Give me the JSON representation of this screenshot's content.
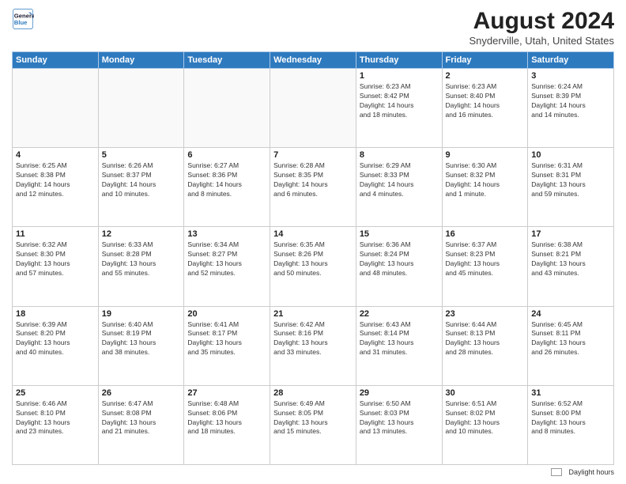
{
  "header": {
    "logo_line1": "General",
    "logo_line2": "Blue",
    "title": "August 2024",
    "subtitle": "Snyderville, Utah, United States"
  },
  "days_of_week": [
    "Sunday",
    "Monday",
    "Tuesday",
    "Wednesday",
    "Thursday",
    "Friday",
    "Saturday"
  ],
  "weeks": [
    [
      {
        "day": "",
        "info": ""
      },
      {
        "day": "",
        "info": ""
      },
      {
        "day": "",
        "info": ""
      },
      {
        "day": "",
        "info": ""
      },
      {
        "day": "1",
        "info": "Sunrise: 6:23 AM\nSunset: 8:42 PM\nDaylight: 14 hours\nand 18 minutes."
      },
      {
        "day": "2",
        "info": "Sunrise: 6:23 AM\nSunset: 8:40 PM\nDaylight: 14 hours\nand 16 minutes."
      },
      {
        "day": "3",
        "info": "Sunrise: 6:24 AM\nSunset: 8:39 PM\nDaylight: 14 hours\nand 14 minutes."
      }
    ],
    [
      {
        "day": "4",
        "info": "Sunrise: 6:25 AM\nSunset: 8:38 PM\nDaylight: 14 hours\nand 12 minutes."
      },
      {
        "day": "5",
        "info": "Sunrise: 6:26 AM\nSunset: 8:37 PM\nDaylight: 14 hours\nand 10 minutes."
      },
      {
        "day": "6",
        "info": "Sunrise: 6:27 AM\nSunset: 8:36 PM\nDaylight: 14 hours\nand 8 minutes."
      },
      {
        "day": "7",
        "info": "Sunrise: 6:28 AM\nSunset: 8:35 PM\nDaylight: 14 hours\nand 6 minutes."
      },
      {
        "day": "8",
        "info": "Sunrise: 6:29 AM\nSunset: 8:33 PM\nDaylight: 14 hours\nand 4 minutes."
      },
      {
        "day": "9",
        "info": "Sunrise: 6:30 AM\nSunset: 8:32 PM\nDaylight: 14 hours\nand 1 minute."
      },
      {
        "day": "10",
        "info": "Sunrise: 6:31 AM\nSunset: 8:31 PM\nDaylight: 13 hours\nand 59 minutes."
      }
    ],
    [
      {
        "day": "11",
        "info": "Sunrise: 6:32 AM\nSunset: 8:30 PM\nDaylight: 13 hours\nand 57 minutes."
      },
      {
        "day": "12",
        "info": "Sunrise: 6:33 AM\nSunset: 8:28 PM\nDaylight: 13 hours\nand 55 minutes."
      },
      {
        "day": "13",
        "info": "Sunrise: 6:34 AM\nSunset: 8:27 PM\nDaylight: 13 hours\nand 52 minutes."
      },
      {
        "day": "14",
        "info": "Sunrise: 6:35 AM\nSunset: 8:26 PM\nDaylight: 13 hours\nand 50 minutes."
      },
      {
        "day": "15",
        "info": "Sunrise: 6:36 AM\nSunset: 8:24 PM\nDaylight: 13 hours\nand 48 minutes."
      },
      {
        "day": "16",
        "info": "Sunrise: 6:37 AM\nSunset: 8:23 PM\nDaylight: 13 hours\nand 45 minutes."
      },
      {
        "day": "17",
        "info": "Sunrise: 6:38 AM\nSunset: 8:21 PM\nDaylight: 13 hours\nand 43 minutes."
      }
    ],
    [
      {
        "day": "18",
        "info": "Sunrise: 6:39 AM\nSunset: 8:20 PM\nDaylight: 13 hours\nand 40 minutes."
      },
      {
        "day": "19",
        "info": "Sunrise: 6:40 AM\nSunset: 8:19 PM\nDaylight: 13 hours\nand 38 minutes."
      },
      {
        "day": "20",
        "info": "Sunrise: 6:41 AM\nSunset: 8:17 PM\nDaylight: 13 hours\nand 35 minutes."
      },
      {
        "day": "21",
        "info": "Sunrise: 6:42 AM\nSunset: 8:16 PM\nDaylight: 13 hours\nand 33 minutes."
      },
      {
        "day": "22",
        "info": "Sunrise: 6:43 AM\nSunset: 8:14 PM\nDaylight: 13 hours\nand 31 minutes."
      },
      {
        "day": "23",
        "info": "Sunrise: 6:44 AM\nSunset: 8:13 PM\nDaylight: 13 hours\nand 28 minutes."
      },
      {
        "day": "24",
        "info": "Sunrise: 6:45 AM\nSunset: 8:11 PM\nDaylight: 13 hours\nand 26 minutes."
      }
    ],
    [
      {
        "day": "25",
        "info": "Sunrise: 6:46 AM\nSunset: 8:10 PM\nDaylight: 13 hours\nand 23 minutes."
      },
      {
        "day": "26",
        "info": "Sunrise: 6:47 AM\nSunset: 8:08 PM\nDaylight: 13 hours\nand 21 minutes."
      },
      {
        "day": "27",
        "info": "Sunrise: 6:48 AM\nSunset: 8:06 PM\nDaylight: 13 hours\nand 18 minutes."
      },
      {
        "day": "28",
        "info": "Sunrise: 6:49 AM\nSunset: 8:05 PM\nDaylight: 13 hours\nand 15 minutes."
      },
      {
        "day": "29",
        "info": "Sunrise: 6:50 AM\nSunset: 8:03 PM\nDaylight: 13 hours\nand 13 minutes."
      },
      {
        "day": "30",
        "info": "Sunrise: 6:51 AM\nSunset: 8:02 PM\nDaylight: 13 hours\nand 10 minutes."
      },
      {
        "day": "31",
        "info": "Sunrise: 6:52 AM\nSunset: 8:00 PM\nDaylight: 13 hours\nand 8 minutes."
      }
    ]
  ],
  "legend": {
    "label": "Daylight hours"
  }
}
